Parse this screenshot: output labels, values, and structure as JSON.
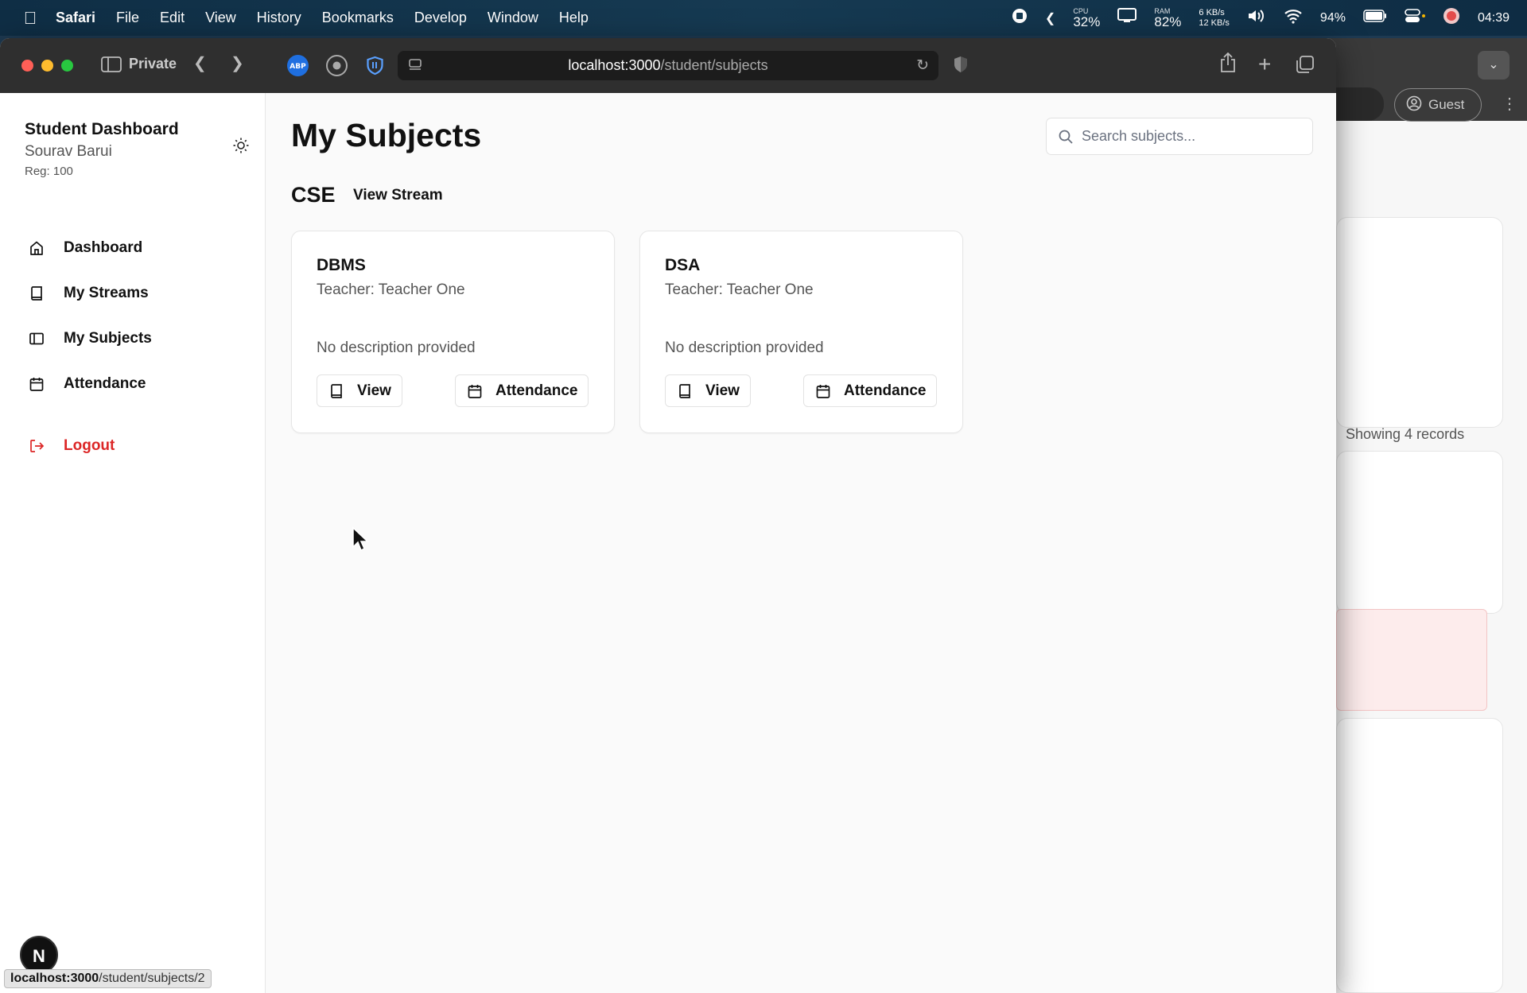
{
  "menubar": {
    "app_name": "Safari",
    "items": [
      "File",
      "Edit",
      "View",
      "History",
      "Bookmarks",
      "Develop",
      "Window",
      "Help"
    ],
    "cpu_label": "CPU",
    "cpu_value": "32%",
    "ram_label": "RAM",
    "ram_value": "82%",
    "net_up": "6 KB/s",
    "net_down": "12 KB/s",
    "battery": "94%",
    "time": "04:39"
  },
  "browser": {
    "private_label": "Private",
    "url_host": "localhost:3000",
    "url_path": "/student/subjects",
    "status_host": "localhost:3000",
    "status_path": "/student/subjects/2"
  },
  "sidebar": {
    "title": "Student Dashboard",
    "user_name": "Sourav Barui",
    "reg": "Reg: 100",
    "nav": [
      {
        "label": "Dashboard",
        "icon": "home-icon"
      },
      {
        "label": "My Streams",
        "icon": "book-icon"
      },
      {
        "label": "My Subjects",
        "icon": "panel-icon"
      },
      {
        "label": "Attendance",
        "icon": "calendar-icon"
      }
    ],
    "logout_label": "Logout",
    "badge": "N"
  },
  "main": {
    "title": "My Subjects",
    "search_placeholder": "Search subjects...",
    "stream_name": "CSE",
    "view_stream_label": "View Stream",
    "subjects": [
      {
        "name": "DBMS",
        "teacher": "Teacher: Teacher One",
        "description": "No description provided",
        "view_label": "View",
        "attendance_label": "Attendance"
      },
      {
        "name": "DSA",
        "teacher": "Teacher: Teacher One",
        "description": "No description provided",
        "view_label": "View",
        "attendance_label": "Attendance"
      }
    ]
  },
  "background_window": {
    "guest_label": "Guest",
    "records_text": "Showing 4 records"
  },
  "colors": {
    "logout": "#dc2626",
    "toolbar": "#2f2f2f",
    "menubar": "#163a52"
  }
}
